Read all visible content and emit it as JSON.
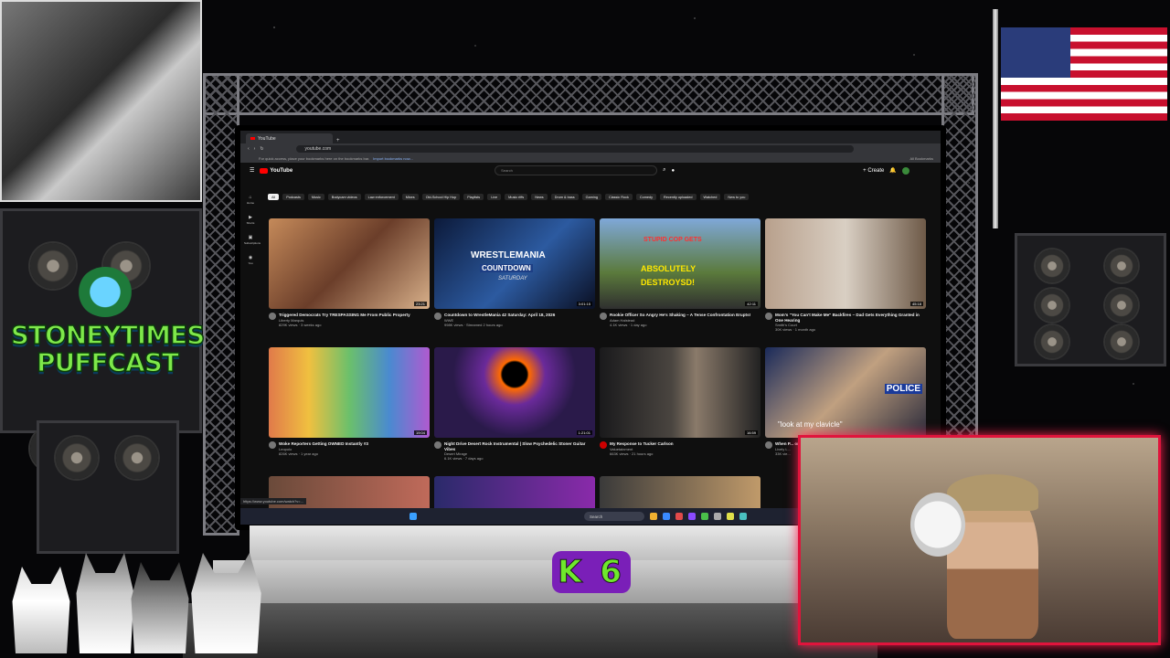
{
  "overlay": {
    "logo_line1": "STONEYTIMES",
    "logo_line2": "PUFFCAST",
    "badge": "K 6"
  },
  "browser": {
    "tab_title": "YouTube",
    "url": "youtube.com",
    "bookmarks_hint": "For quick access, place your bookmarks here on the bookmarks bar.",
    "bookmarks_link": "Import bookmarks now...",
    "all_bookmarks": "All Bookmarks",
    "status_url": "https://www.youtube.com/watch?v=..."
  },
  "youtube": {
    "logo": "YouTube",
    "search_placeholder": "Search",
    "create_label": "Create",
    "chips": [
      "All",
      "Podcasts",
      "Music",
      "Bodycam videos",
      "Law enforcement",
      "Mixes",
      "Old-School Hip Hop",
      "Playlists",
      "Live",
      "Music riffs",
      "News",
      "Drum & bass",
      "Gaming",
      "Classic Rock",
      "Comedy",
      "Recently uploaded",
      "Watched",
      "New to you"
    ],
    "sidebar": [
      "Home",
      "Shorts",
      "Subscriptions",
      "You"
    ],
    "videos": [
      {
        "title": "Triggered Democrats Try TRESPASSING Me From Public Property",
        "channel": "Liberty Marquis",
        "stats": "829K views · 3 weeks ago",
        "duration": "23:21",
        "thumb_color": "#8a5b3b"
      },
      {
        "title": "Countdown to WrestleMania 42 Saturday: April 18, 2026",
        "channel": "WWE",
        "stats": "998K views · Streamed 2 hours ago",
        "duration": "3:01:15",
        "thumb_color": "#1b2c5c"
      },
      {
        "title": "Rookie Officer So Angry He's Shaking – A Tense Confrontation Erupts!",
        "channel": "Adam Halstead",
        "stats": "4.1K views · 1 day ago",
        "duration": "42:11",
        "thumb_color": "#566a3c"
      },
      {
        "title": "Mom's \"You Can't Make Me\" Backfires – Dad Gets Everything Granted in One Hearing",
        "channel": "Smith's Court",
        "stats": "30K views · 1 month ago",
        "duration": "45:18",
        "thumb_color": "#7c6c5a"
      },
      {
        "title": "Woke Reporters Getting OWNED Instantly #3",
        "channel": "Leopolo",
        "stats": "826K views · 1 year ago",
        "duration": "19:04",
        "thumb_color": "#b96b49"
      },
      {
        "title": "Night Drive Desert Rock Instrumental | Slow Psychedelic Stoner Guitar Vibes",
        "channel": "Desert Mirage",
        "stats": "6.1K views · 7 days ago",
        "duration": "1:21:01",
        "thumb_color": "#4a2a6c"
      },
      {
        "title": "My Response to Tucker Carlson",
        "channel": "Valuetainment",
        "stats": "663K views · 21 hours ago",
        "duration": "16:59",
        "thumb_color": "#2b2b2f"
      },
      {
        "title": "When P... on Cam...",
        "channel": "Lively L...",
        "stats": "33K vie...",
        "duration": "",
        "thumb_color": "#3a2a2a"
      }
    ],
    "thumb_overlays": {
      "wrestlemania": "WRESTLEMANIA",
      "countdown": "COUNTDOWN",
      "saturday": "SATURDAY",
      "cop1": "STUPID COP GETS",
      "cop2": "ABSOLUTELY",
      "cop3": "DESTROYSD!",
      "clavicle": "\"look at my clavicle\"",
      "police": "POLICE"
    }
  },
  "taskbar": {
    "search": "Search"
  },
  "colors": {
    "accent": "#e0143c",
    "logo_green": "#7ee84a",
    "badge_purple": "#7a1fb8",
    "yt_red": "#ff0000"
  }
}
